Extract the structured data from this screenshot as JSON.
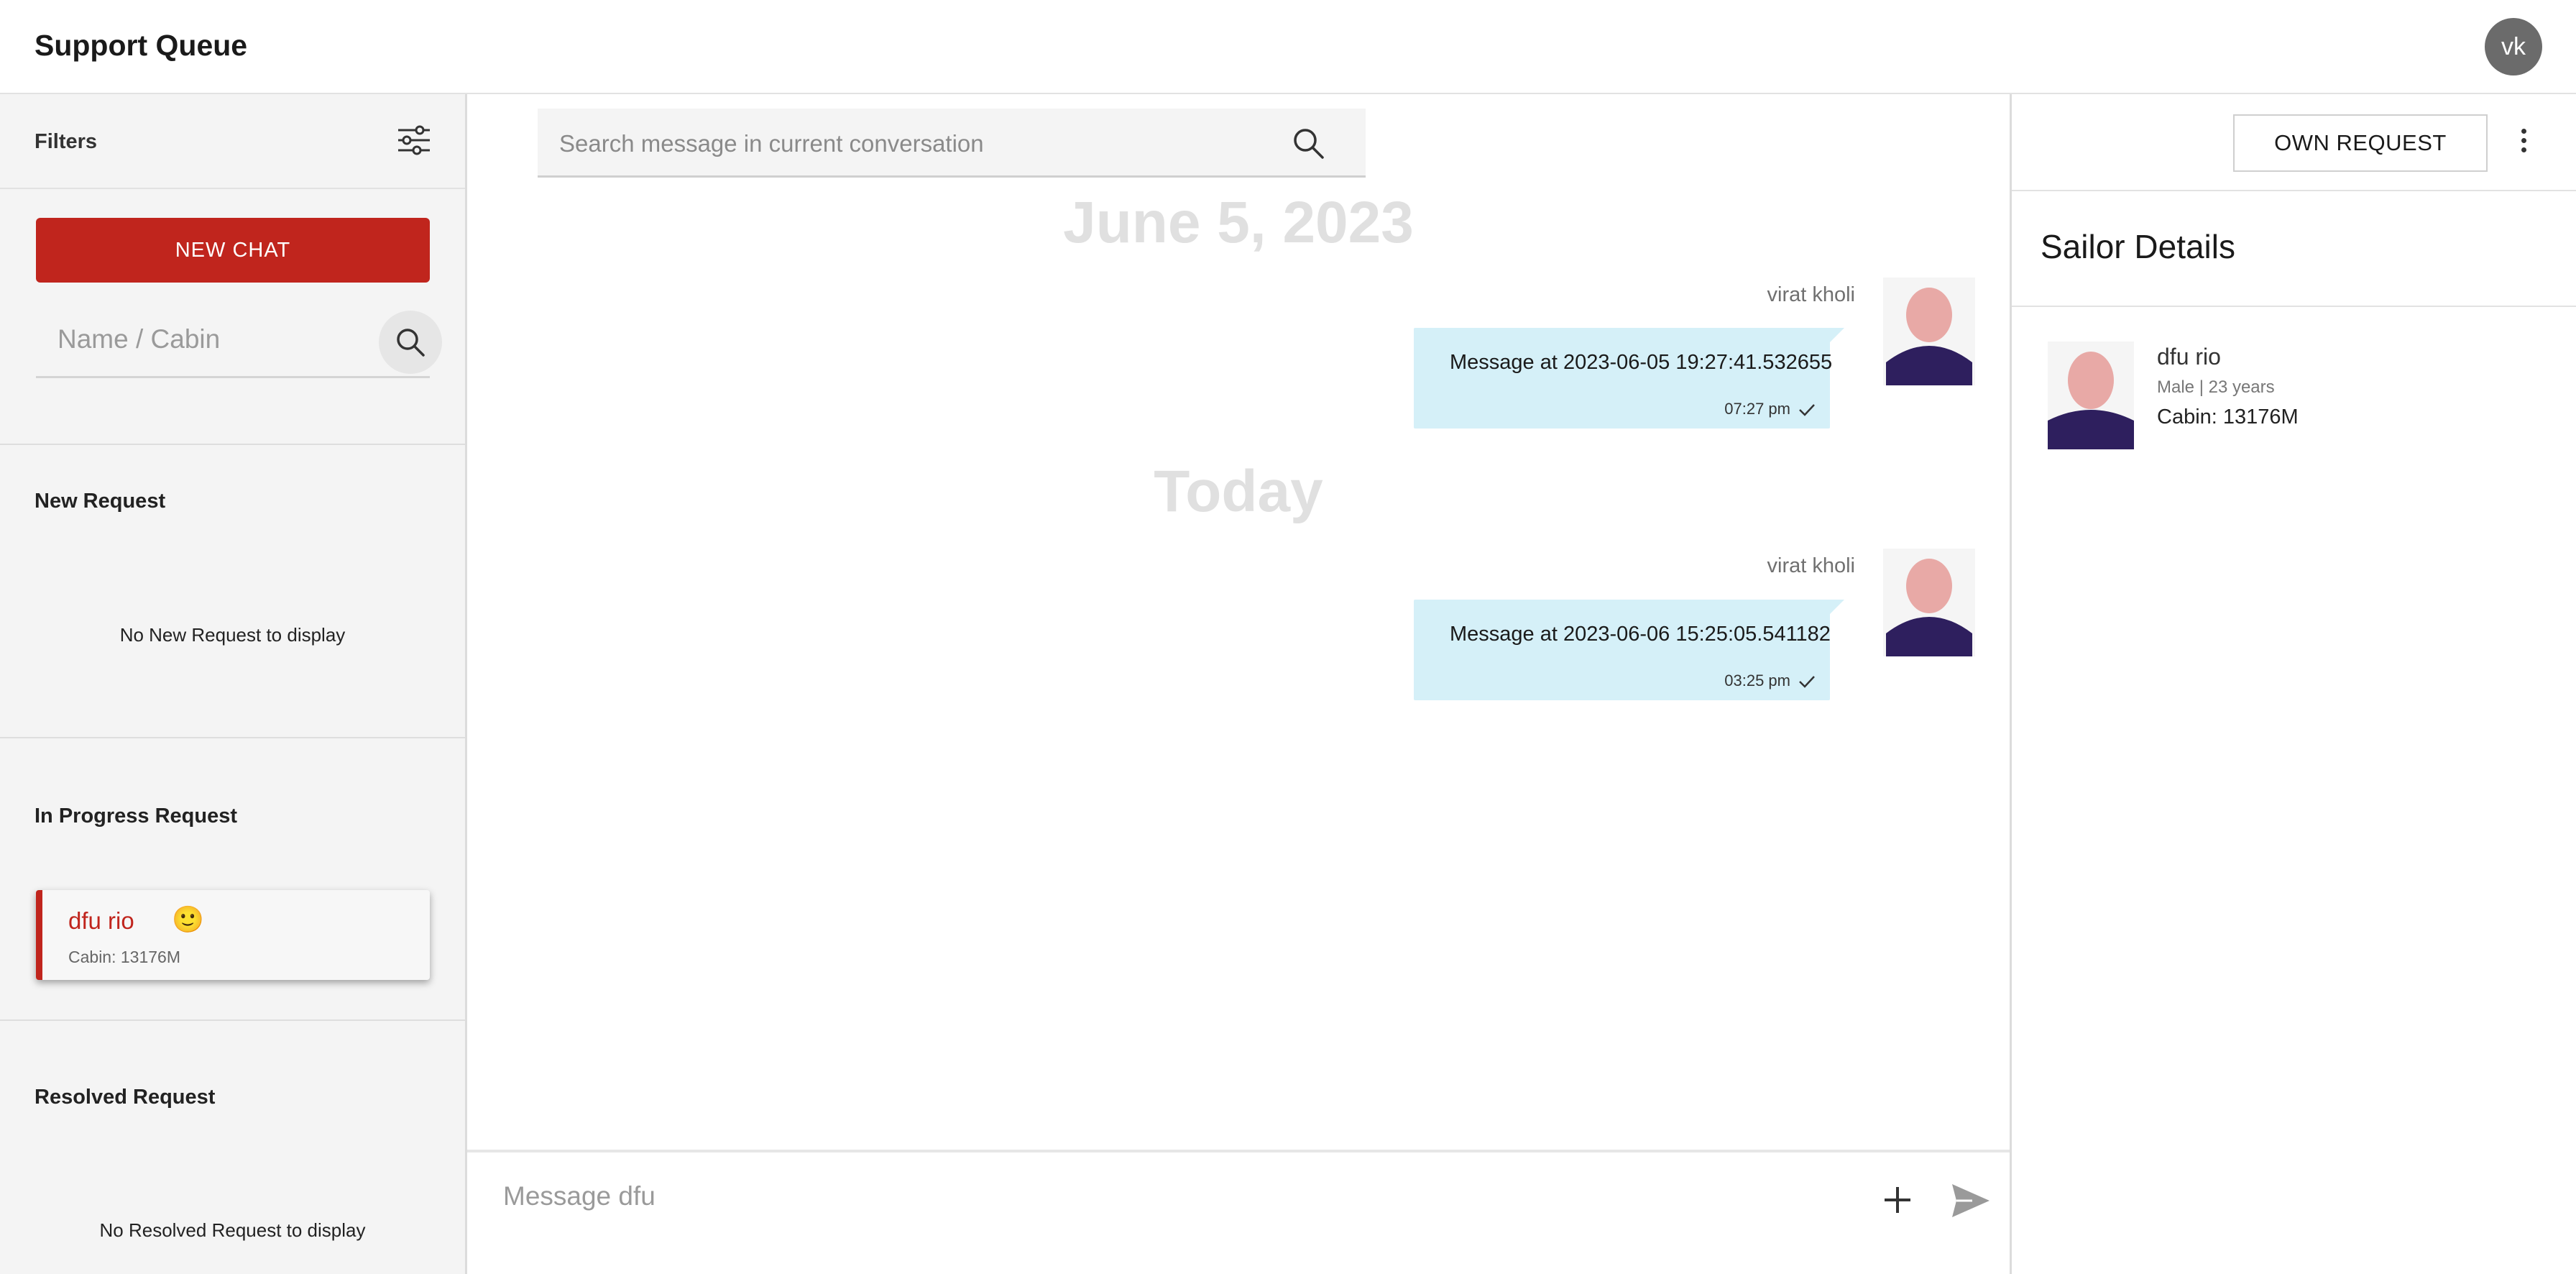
{
  "header": {
    "title": "Support Queue",
    "user_initials": "vk"
  },
  "sidebar": {
    "filters_label": "Filters",
    "new_chat_label": "NEW CHAT",
    "search_placeholder": "Name / Cabin",
    "new_request": {
      "title": "New Request",
      "empty_text": "No New Request to display"
    },
    "in_progress": {
      "title": "In Progress Request",
      "items": [
        {
          "name": "dfu rio",
          "emoji": "🙂",
          "cabin": "Cabin: 13176M"
        }
      ]
    },
    "resolved": {
      "title": "Resolved Request",
      "empty_text": "No Resolved Request to display"
    }
  },
  "chat": {
    "search_placeholder": "Search message in current conversation",
    "groups": [
      {
        "date_label": "June 5, 2023",
        "messages": [
          {
            "sender": "virat kholi",
            "text": "Message at 2023-06-05 19:27:41.532655",
            "time": "07:27 pm"
          }
        ]
      },
      {
        "date_label": "Today",
        "messages": [
          {
            "sender": "virat kholi",
            "text": "Message at 2023-06-06 15:25:05.541182",
            "time": "03:25 pm"
          }
        ]
      }
    ],
    "composer_placeholder": "Message dfu"
  },
  "details": {
    "own_request_label": "OWN REQUEST",
    "title": "Sailor Details",
    "sailor": {
      "name": "dfu rio",
      "meta": "Male | 23 years",
      "cabin": "Cabin: 13176M"
    }
  },
  "colors": {
    "accent": "#c0251d",
    "bubble": "#d5f0f8",
    "avatar_head": "#e8a9a6",
    "avatar_body": "#2e1f5e"
  }
}
